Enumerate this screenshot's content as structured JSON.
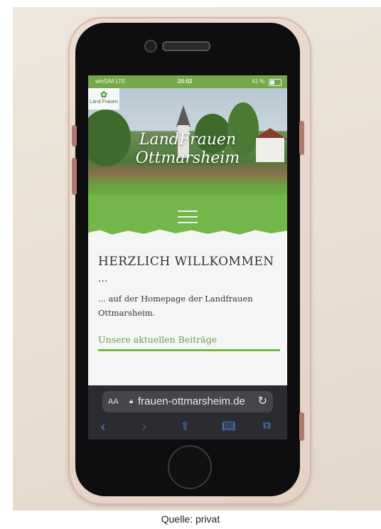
{
  "caption": "Quelle: privat",
  "status": {
    "carrier": "winSIM LTE",
    "time": "20:02",
    "battery": "41 %"
  },
  "site": {
    "logo_top": "Land",
    "logo_bottom": "Frauen",
    "title_line1": "LandFrauen",
    "title_line2": "Ottmarsheim",
    "heading": "HERZLICH WILLKOMMEN",
    "ellipsis": "...",
    "intro": "... auf der Homepage der Landfrauen Ottmarsheim.",
    "section_link": "Unsere aktuellen Beiträge"
  },
  "browser": {
    "text_size": "AA",
    "url": "frauen-ottmarsheim.de"
  },
  "icons": [
    "back-icon",
    "forward-icon",
    "share-icon",
    "bookmarks-icon",
    "tabs-icon",
    "lock-icon",
    "reload-icon",
    "menu-icon"
  ],
  "colors": {
    "brand_green": "#73b74a",
    "url_bar": "#2b2c30",
    "safari_blue": "#4a8fe8"
  }
}
